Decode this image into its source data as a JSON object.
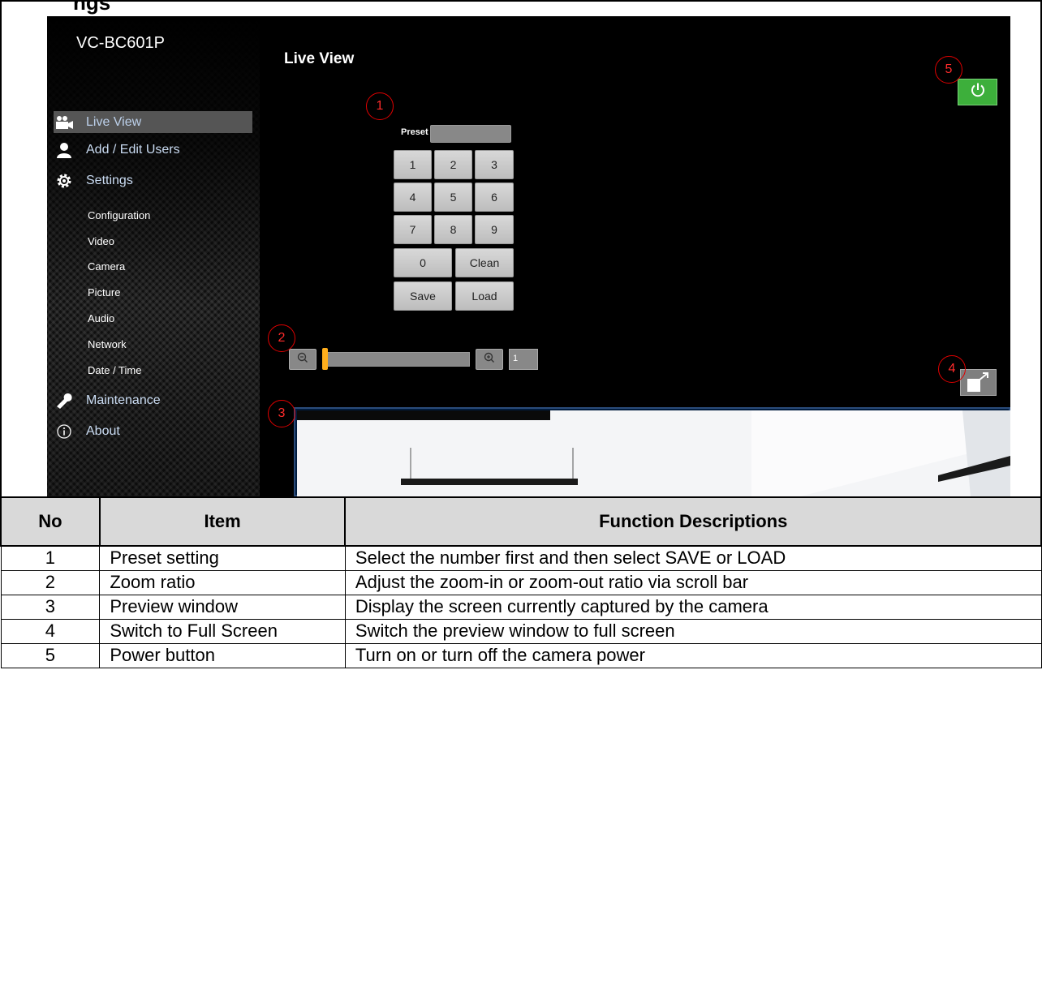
{
  "page_heading_cut": "ngs",
  "app": {
    "model_name": "VC-BC601P",
    "page_title": "Live View",
    "sidebar": {
      "nav": [
        {
          "label": "Live View",
          "icon": "video-camera-icon",
          "active": true
        },
        {
          "label": "Add / Edit Users",
          "icon": "user-icon",
          "active": false
        },
        {
          "label": "Settings",
          "icon": "gear-icon",
          "active": false
        }
      ],
      "settings_sub": [
        "Configuration",
        "Video",
        "Camera",
        "Picture",
        "Audio",
        "Network",
        "Date / Time"
      ],
      "nav_bottom": [
        {
          "label": "Maintenance",
          "icon": "wrench-icon"
        },
        {
          "label": "About",
          "icon": "info-icon"
        }
      ]
    },
    "preset": {
      "label": "Preset",
      "value": "",
      "keys": [
        "1",
        "2",
        "3",
        "4",
        "5",
        "6",
        "7",
        "8",
        "9",
        "0",
        "Clean",
        "Save",
        "Load"
      ]
    },
    "zoom": {
      "value": "1",
      "position_fraction": 0.0
    },
    "callouts": [
      "1",
      "2",
      "3",
      "4",
      "5"
    ],
    "colors": {
      "power": "#3daf3b",
      "zoom_thumb": "#ffae1c",
      "nav_text": "#c9dbf2",
      "preview_border": "#2a4b7a"
    }
  },
  "table": {
    "headers": [
      "No",
      "Item",
      "Function Descriptions"
    ],
    "rows": [
      [
        "1",
        "Preset setting",
        "Select the number first and then select SAVE or LOAD"
      ],
      [
        "2",
        "Zoom ratio",
        "Adjust the zoom-in or zoom-out ratio via scroll bar"
      ],
      [
        "3",
        "Preview window",
        "Display the screen currently captured by the camera"
      ],
      [
        "4",
        "Switch to Full Screen",
        "Switch the preview window to full screen"
      ],
      [
        "5",
        "Power button",
        "Turn on or turn off the camera power"
      ]
    ]
  }
}
